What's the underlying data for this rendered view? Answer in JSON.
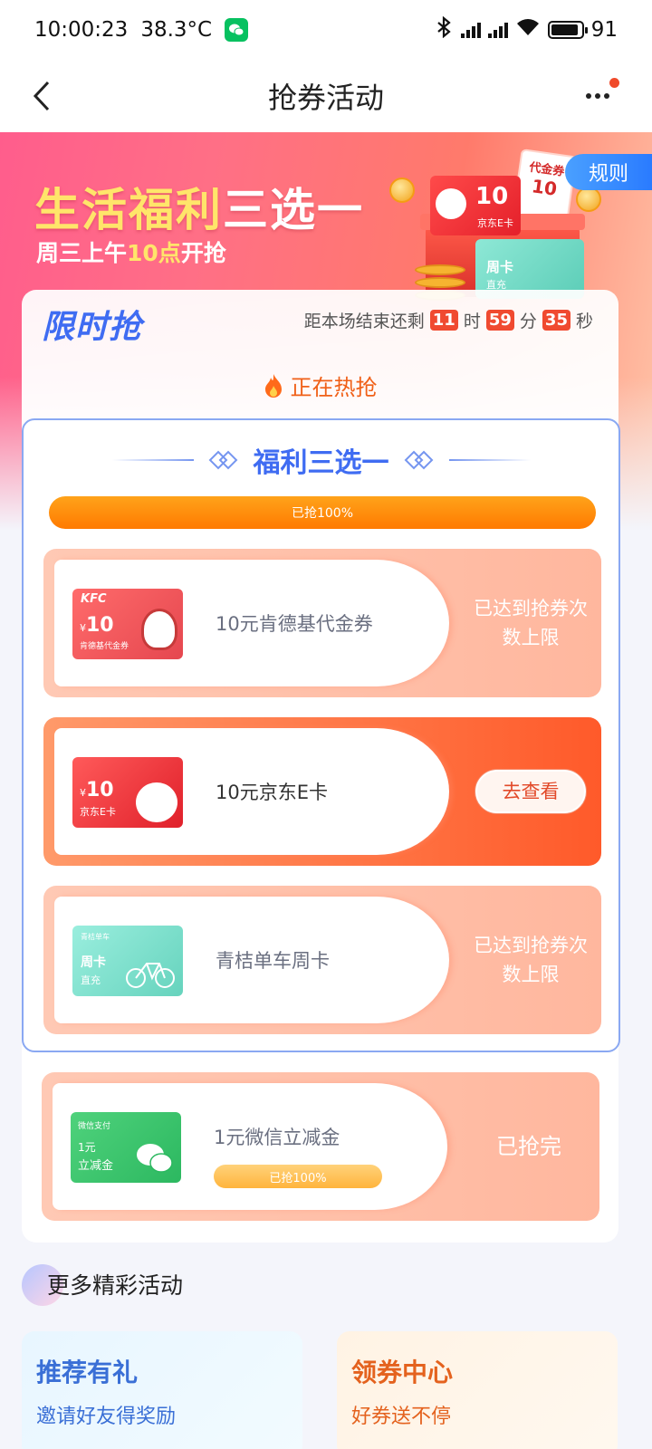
{
  "status_bar": {
    "time": "10:00:23",
    "temperature": "38.3°C",
    "battery": "91",
    "battery_level": 0.91
  },
  "nav": {
    "title": "抢券活动"
  },
  "banner": {
    "title_part1": "生活福利",
    "title_part2": "三选一",
    "subtitle_pre": "周三上午",
    "subtitle_num": "10点",
    "subtitle_post": "开抢",
    "rules_label": "规则",
    "illustration": {
      "jd_card_value": "10",
      "jd_card_label": "京东E卡",
      "voucher_label": "代金券",
      "voucher_value": "10",
      "bike_card_label": "周卡",
      "bike_card_sub": "直充"
    }
  },
  "flash": {
    "logo": "限时抢",
    "countdown_prefix": "距本场结束还剩",
    "hours": "11",
    "hours_unit": "时",
    "minutes": "59",
    "minutes_unit": "分",
    "seconds": "35",
    "seconds_unit": "秒",
    "hot_tab_label": "正在热抢"
  },
  "choice": {
    "title": "福利三选一",
    "progress_label": "已抢100%",
    "progress_value": 1.0
  },
  "coupons": [
    {
      "name": "10元肯德基代金券",
      "status": "已达到抢券次数上限",
      "thumb": {
        "brand": "KFC",
        "currency": "¥",
        "value": "10",
        "sub": "肯德基代金券"
      }
    },
    {
      "name": "10元京东E卡",
      "action": "去查看",
      "thumb": {
        "currency": "¥",
        "value": "10",
        "sub": "京东E卡"
      }
    },
    {
      "name": "青桔单车周卡",
      "status": "已达到抢券次数上限",
      "thumb": {
        "brand": "青桔单车",
        "title": "周卡",
        "sub": "直充"
      }
    }
  ],
  "extra_coupon": {
    "name": "1元微信立减金",
    "progress_label": "已抢100%",
    "progress_value": 1.0,
    "status": "已抢完",
    "thumb": {
      "brand": "微信支付",
      "value": "1元",
      "sub": "立减金"
    }
  },
  "more": {
    "title": "更多精彩活动",
    "cards": [
      {
        "title": "推荐有礼",
        "subtitle": "邀请好友得奖励"
      },
      {
        "title": "领券中心",
        "subtitle": "好券送不停"
      }
    ]
  },
  "colors": {
    "accent_blue": "#3f6cf2",
    "accent_orange": "#ff7a00",
    "countdown_red": "#f04a30",
    "wechat_green": "#07c160"
  },
  "icons": [
    "wechat-icon",
    "bluetooth-icon",
    "signal-icon",
    "wifi-icon",
    "battery-icon",
    "back-icon",
    "more-icon",
    "flame-icon",
    "diamond-deco-icon"
  ]
}
